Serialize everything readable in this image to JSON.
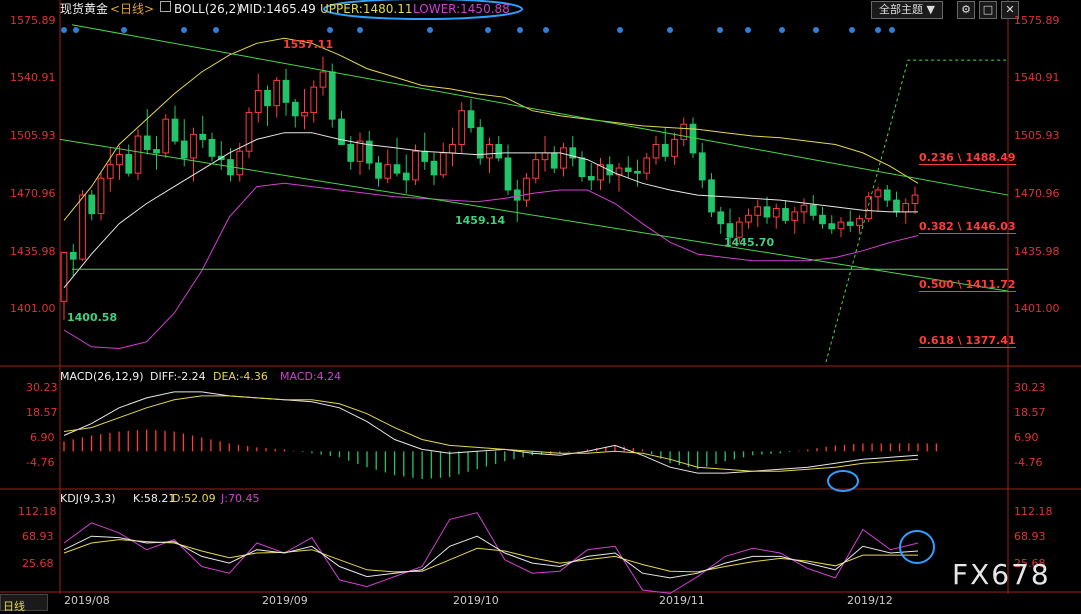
{
  "toolbar": {
    "instrument": "现货黄金",
    "period": "<日线>",
    "boll_name": "BOLL(26,2)",
    "mid": "MID:1465.49",
    "upper": "UPPER:1480.11",
    "lower": "LOWER:1450.88",
    "theme_button": "全部主题",
    "colors": {
      "mid": "#e8e8e8",
      "upper": "#e6d84a",
      "lower": "#d23fd2"
    }
  },
  "macd_legend": {
    "name": "MACD(26,12,9)",
    "diff": "DIFF:-2.24",
    "dea": "DEA:-4.36",
    "macd": "MACD:4.24"
  },
  "kdj_legend": {
    "name": "KDJ(9,3,3)",
    "k": "K:58.21",
    "d": "D:52.09",
    "j": "J:70.45"
  },
  "corner_label": "日线",
  "watermark": "FX678",
  "chart_data": [
    {
      "type": "candlestick",
      "title": "现货黄金 日线",
      "y_ticks": [
        "1575.89",
        "1540.91",
        "1505.93",
        "1470.96",
        "1435.98",
        "1401.00"
      ],
      "ylim": [
        1376,
        1580
      ],
      "x_ticks": [
        "2019/08",
        "2019/09",
        "2019/10",
        "2019/11",
        "2019/12"
      ],
      "annotations": [
        {
          "text": "1557.11",
          "kind": "high",
          "value": 1557.11
        },
        {
          "text": "1459.14",
          "kind": "low",
          "value": 1459.14
        },
        {
          "text": "1445.70",
          "kind": "low",
          "value": 1445.7
        },
        {
          "text": "1400.58",
          "kind": "low",
          "value": 1400.58
        }
      ],
      "fibonacci": [
        {
          "text": "0.236 \\ 1488.49",
          "value": 1488.49
        },
        {
          "text": "0.382 \\ 1446.03",
          "value": 1446.03
        },
        {
          "text": "0.500 \\ 1411.72",
          "value": 1411.72
        },
        {
          "text": "0.618 \\ 1377.41",
          "value": 1377.41
        }
      ],
      "candles": [
        [
          1412,
          1441,
          1401,
          1441
        ],
        [
          1441,
          1446,
          1427,
          1437
        ],
        [
          1437,
          1478,
          1436,
          1475
        ],
        [
          1475,
          1478,
          1460,
          1464
        ],
        [
          1464,
          1489,
          1460,
          1485
        ],
        [
          1485,
          1503,
          1477,
          1493
        ],
        [
          1493,
          1504,
          1484,
          1499
        ],
        [
          1499,
          1505,
          1486,
          1488
        ],
        [
          1488,
          1514,
          1484,
          1510
        ],
        [
          1510,
          1526,
          1499,
          1502
        ],
        [
          1502,
          1510,
          1490,
          1500
        ],
        [
          1500,
          1523,
          1497,
          1520
        ],
        [
          1520,
          1528,
          1505,
          1507
        ],
        [
          1507,
          1520,
          1492,
          1497
        ],
        [
          1497,
          1515,
          1483,
          1511
        ],
        [
          1511,
          1522,
          1503,
          1508
        ],
        [
          1508,
          1512,
          1495,
          1498
        ],
        [
          1498,
          1507,
          1490,
          1496
        ],
        [
          1496,
          1503,
          1483,
          1487
        ],
        [
          1487,
          1506,
          1483,
          1501
        ],
        [
          1501,
          1527,
          1497,
          1524
        ],
        [
          1524,
          1547,
          1518,
          1537
        ],
        [
          1537,
          1540,
          1516,
          1528
        ],
        [
          1528,
          1545,
          1521,
          1543
        ],
        [
          1543,
          1550,
          1522,
          1530
        ],
        [
          1530,
          1532,
          1515,
          1522
        ],
        [
          1522,
          1538,
          1514,
          1524
        ],
        [
          1524,
          1543,
          1518,
          1539
        ],
        [
          1539,
          1557,
          1534,
          1548
        ],
        [
          1548,
          1553,
          1515,
          1520
        ],
        [
          1520,
          1525,
          1505,
          1505
        ],
        [
          1505,
          1510,
          1490,
          1495
        ],
        [
          1495,
          1512,
          1487,
          1507
        ],
        [
          1507,
          1513,
          1490,
          1494
        ],
        [
          1494,
          1498,
          1480,
          1485
        ],
        [
          1485,
          1502,
          1482,
          1493
        ],
        [
          1493,
          1509,
          1486,
          1488
        ],
        [
          1488,
          1499,
          1476,
          1484
        ],
        [
          1484,
          1505,
          1481,
          1501
        ],
        [
          1501,
          1512,
          1490,
          1495
        ],
        [
          1495,
          1500,
          1481,
          1487
        ],
        [
          1487,
          1506,
          1485,
          1500
        ],
        [
          1500,
          1515,
          1492,
          1505
        ],
        [
          1505,
          1530,
          1500,
          1525
        ],
        [
          1525,
          1532,
          1512,
          1515
        ],
        [
          1515,
          1520,
          1493,
          1497
        ],
        [
          1497,
          1509,
          1488,
          1505
        ],
        [
          1505,
          1510,
          1495,
          1497
        ],
        [
          1497,
          1505,
          1475,
          1478
        ],
        [
          1478,
          1484,
          1459,
          1472
        ],
        [
          1472,
          1488,
          1468,
          1485
        ],
        [
          1485,
          1500,
          1482,
          1496
        ],
        [
          1496,
          1510,
          1489,
          1500
        ],
        [
          1500,
          1504,
          1488,
          1491
        ],
        [
          1491,
          1506,
          1486,
          1503
        ],
        [
          1503,
          1510,
          1492,
          1497
        ],
        [
          1497,
          1501,
          1483,
          1486
        ],
        [
          1486,
          1494,
          1478,
          1484
        ],
        [
          1484,
          1497,
          1478,
          1493
        ],
        [
          1493,
          1498,
          1482,
          1487
        ],
        [
          1487,
          1494,
          1477,
          1491
        ],
        [
          1491,
          1498,
          1485,
          1489
        ],
        [
          1489,
          1496,
          1480,
          1488
        ],
        [
          1488,
          1500,
          1484,
          1497
        ],
        [
          1497,
          1510,
          1493,
          1505
        ],
        [
          1505,
          1515,
          1495,
          1498
        ],
        [
          1498,
          1512,
          1493,
          1508
        ],
        [
          1508,
          1521,
          1504,
          1517
        ],
        [
          1517,
          1521,
          1497,
          1500
        ],
        [
          1500,
          1506,
          1479,
          1484
        ],
        [
          1484,
          1488,
          1462,
          1465
        ],
        [
          1465,
          1468,
          1452,
          1458
        ],
        [
          1458,
          1467,
          1446,
          1450
        ],
        [
          1450,
          1462,
          1447,
          1459
        ],
        [
          1459,
          1467,
          1455,
          1463
        ],
        [
          1463,
          1472,
          1456,
          1468
        ],
        [
          1468,
          1474,
          1458,
          1462
        ],
        [
          1462,
          1470,
          1455,
          1467
        ],
        [
          1467,
          1472,
          1458,
          1460
        ],
        [
          1460,
          1468,
          1452,
          1465
        ],
        [
          1465,
          1473,
          1458,
          1469
        ],
        [
          1469,
          1475,
          1460,
          1463
        ],
        [
          1463,
          1468,
          1455,
          1458
        ],
        [
          1458,
          1463,
          1452,
          1455
        ],
        [
          1455,
          1462,
          1450,
          1459
        ],
        [
          1459,
          1466,
          1453,
          1457
        ],
        [
          1457,
          1463,
          1452,
          1461
        ],
        [
          1461,
          1477,
          1459,
          1474
        ],
        [
          1474,
          1480,
          1465,
          1478
        ],
        [
          1478,
          1481,
          1468,
          1472
        ],
        [
          1472,
          1477,
          1462,
          1465
        ],
        [
          1465,
          1473,
          1458,
          1470
        ],
        [
          1470,
          1480,
          1464,
          1475
        ]
      ],
      "boll_upper": [
        1460,
        1480,
        1505,
        1520,
        1535,
        1548,
        1558,
        1565,
        1568,
        1565,
        1558,
        1550,
        1545,
        1540,
        1538,
        1535,
        1533,
        1525,
        1522,
        1520,
        1518,
        1516,
        1515,
        1514,
        1512,
        1510,
        1509,
        1507,
        1505,
        1500,
        1492,
        1482
      ],
      "boll_mid": [
        1420,
        1440,
        1458,
        1470,
        1480,
        1490,
        1500,
        1508,
        1512,
        1512,
        1508,
        1505,
        1503,
        1501,
        1500,
        1499,
        1500,
        1500,
        1500,
        1496,
        1488,
        1482,
        1478,
        1475,
        1474,
        1473,
        1472,
        1470,
        1468,
        1466,
        1465,
        1465
      ],
      "boll_lower": [
        1395,
        1385,
        1384,
        1388,
        1405,
        1430,
        1462,
        1480,
        1482,
        1480,
        1478,
        1476,
        1474,
        1473,
        1472,
        1471,
        1473,
        1476,
        1478,
        1478,
        1470,
        1458,
        1447,
        1440,
        1438,
        1436,
        1436,
        1436,
        1438,
        1442,
        1447,
        1451
      ]
    },
    {
      "type": "bar",
      "name": "MACD(26,12,9)",
      "y_ticks": [
        "30.23",
        "18.57",
        "6.90",
        "-4.76"
      ],
      "ylim": [
        -18,
        34
      ],
      "series": [
        {
          "name": "DIFF",
          "values": [
            8,
            14,
            22,
            27,
            30,
            30,
            28,
            27,
            26,
            25,
            22,
            15,
            6,
            1,
            -1,
            0,
            1,
            -1,
            -2,
            0,
            3,
            -2,
            -8,
            -11,
            -11,
            -10,
            -9,
            -8,
            -6,
            -4,
            -3,
            -2
          ]
        },
        {
          "name": "DEA",
          "values": [
            10,
            12,
            17,
            22,
            26,
            28,
            28,
            27,
            26,
            26,
            24,
            19,
            12,
            6,
            3,
            2,
            1,
            0,
            -1,
            -1,
            0,
            -1,
            -4,
            -8,
            -9,
            -10,
            -10,
            -9,
            -8,
            -6,
            -5,
            -4
          ]
        },
        {
          "name": "MACD",
          "values": [
            5,
            8,
            10,
            11,
            10,
            7,
            4,
            2,
            1,
            -1,
            -3,
            -8,
            -12,
            -14,
            -13,
            -9,
            -5,
            -2,
            -1,
            1,
            3,
            1,
            -6,
            -9,
            -5,
            -2,
            -1,
            1,
            3,
            4,
            4,
            4
          ]
        }
      ]
    },
    {
      "type": "line",
      "name": "KDJ(9,3,3)",
      "y_ticks": [
        "112.18",
        "68.93",
        "25.68"
      ],
      "ylim": [
        0,
        125
      ],
      "series": [
        {
          "name": "K",
          "values": [
            60,
            80,
            78,
            70,
            72,
            50,
            40,
            60,
            55,
            65,
            35,
            20,
            25,
            30,
            65,
            80,
            55,
            40,
            35,
            50,
            55,
            25,
            18,
            25,
            40,
            50,
            50,
            40,
            30,
            65,
            55,
            58
          ]
        },
        {
          "name": "D",
          "values": [
            55,
            70,
            75,
            72,
            70,
            58,
            48,
            55,
            56,
            60,
            45,
            30,
            27,
            28,
            45,
            62,
            58,
            48,
            40,
            45,
            50,
            38,
            28,
            27,
            35,
            42,
            47,
            43,
            36,
            52,
            52,
            52
          ]
        },
        {
          "name": "J",
          "values": [
            70,
            100,
            85,
            60,
            75,
            35,
            25,
            70,
            55,
            78,
            15,
            5,
            20,
            35,
            105,
            115,
            45,
            25,
            28,
            60,
            65,
            0,
            -5,
            20,
            50,
            62,
            55,
            32,
            18,
            90,
            60,
            70
          ]
        }
      ]
    }
  ]
}
